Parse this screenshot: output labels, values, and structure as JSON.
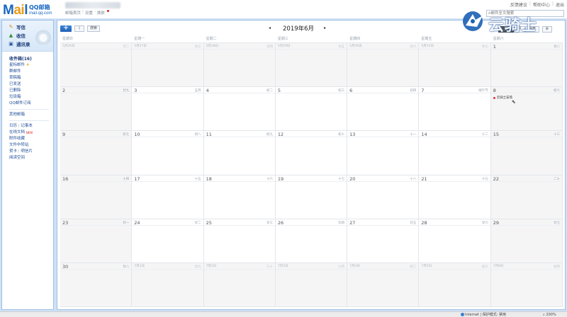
{
  "header": {
    "logo_main_a": "M",
    "logo_main_b": "ai",
    "logo_main_c": "l",
    "logo_qq": "QQ邮箱",
    "logo_domain": "mail.qq.com",
    "links": [
      "邮箱首页",
      "设置",
      "换肤"
    ],
    "top_links": [
      "反馈建议",
      "帮助中心",
      "退出"
    ],
    "search_placeholder": "邮件全文搜索",
    "watermark": "云骑士"
  },
  "sidebar": {
    "write": "写信",
    "receive": "收信",
    "contacts": "通讯录",
    "folders": {
      "inbox": "收件箱(16)",
      "starred": "星标邮件",
      "groups": "群邮件",
      "draft_box": "草稿箱",
      "sent": "已发送",
      "deleted": "已删除",
      "spam": "垃圾箱",
      "qq_subscribe": "QQ邮件订阅",
      "other": "其他邮箱",
      "calendar": "日历",
      "notepad": "记事本",
      "doc": "在线文档",
      "doc_badge": "NEW",
      "attach": "附件收藏",
      "transfer": "文件中转站",
      "card": "贺卡",
      "postcard": "明信片",
      "read": "阅读空间"
    }
  },
  "toolbar": {
    "new_label": "+",
    "doc_label": "▯",
    "search_label": "搜索",
    "prev": "◂",
    "next": "▸",
    "month": "2019年6月",
    "views": [
      "周",
      "月",
      "列表"
    ],
    "gear": "⚙"
  },
  "calendar": {
    "weekdays": [
      "星期日",
      "星期一",
      "星期二",
      "星期三",
      "星期四",
      "星期五",
      "星期六"
    ],
    "weeks": [
      [
        {
          "d": "5月26日",
          "l": "廿二",
          "o": true
        },
        {
          "d": "5月27日",
          "l": "廿三",
          "o": true
        },
        {
          "d": "5月28日",
          "l": "廿四",
          "o": true
        },
        {
          "d": "5月29日",
          "l": "廿五",
          "o": true
        },
        {
          "d": "5月30日",
          "l": "廿六",
          "o": true
        },
        {
          "d": "5月31日",
          "l": "廿七",
          "o": true
        },
        {
          "d": "1",
          "l": "廿八",
          "w": true
        }
      ],
      [
        {
          "d": "2",
          "l": "廿九",
          "w": true
        },
        {
          "d": "3",
          "l": "五月"
        },
        {
          "d": "4",
          "l": "初二"
        },
        {
          "d": "5",
          "l": "初三"
        },
        {
          "d": "6",
          "l": "初四"
        },
        {
          "d": "7",
          "l": "端午节"
        },
        {
          "d": "8",
          "l": "初六",
          "w": true,
          "e": "云骑士安装"
        }
      ],
      [
        {
          "d": "9",
          "l": "初七",
          "w": true
        },
        {
          "d": "10",
          "l": "初八"
        },
        {
          "d": "11",
          "l": "初九"
        },
        {
          "d": "12",
          "l": "初十"
        },
        {
          "d": "13",
          "l": "十一"
        },
        {
          "d": "14",
          "l": "十二"
        },
        {
          "d": "15",
          "l": "十三",
          "w": true
        }
      ],
      [
        {
          "d": "16",
          "l": "十四",
          "w": true
        },
        {
          "d": "17",
          "l": "十五"
        },
        {
          "d": "18",
          "l": "十六"
        },
        {
          "d": "19",
          "l": "十七"
        },
        {
          "d": "20",
          "l": "十八"
        },
        {
          "d": "21",
          "l": "十九"
        },
        {
          "d": "22",
          "l": "二十",
          "w": true
        }
      ],
      [
        {
          "d": "23",
          "l": "廿一",
          "w": true
        },
        {
          "d": "24",
          "l": "廿二"
        },
        {
          "d": "25",
          "l": "廿三"
        },
        {
          "d": "26",
          "l": "廿四"
        },
        {
          "d": "27",
          "l": "廿五"
        },
        {
          "d": "28",
          "l": "廿六"
        },
        {
          "d": "29",
          "l": "廿七",
          "w": true
        }
      ],
      [
        {
          "d": "30",
          "l": "廿八",
          "w": true
        },
        {
          "d": "7月1日",
          "l": "廿九",
          "o": true
        },
        {
          "d": "7月2日",
          "l": "三十",
          "o": true
        },
        {
          "d": "7月3日",
          "l": "六月",
          "o": true
        },
        {
          "d": "7月4日",
          "l": "初二",
          "o": true
        },
        {
          "d": "7月5日",
          "l": "初三",
          "o": true
        },
        {
          "d": "7月6日",
          "l": "初四",
          "o": true
        }
      ]
    ]
  },
  "status": {
    "zone": "Internet | 保护模式: 禁用",
    "zoom": "200%"
  }
}
